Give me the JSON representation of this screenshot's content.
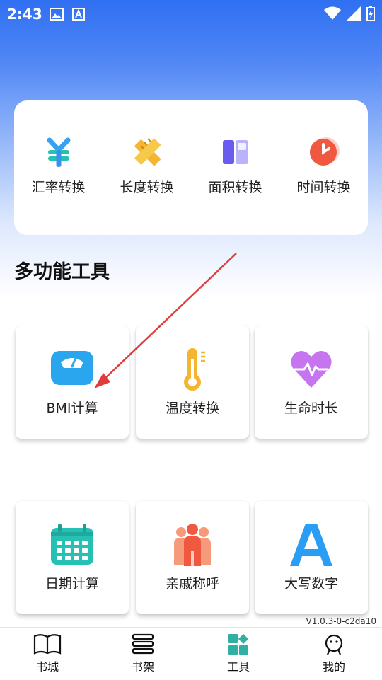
{
  "status_bar": {
    "time": "2:43"
  },
  "converters": [
    {
      "label": "汇率转换",
      "icon": "yen-icon"
    },
    {
      "label": "长度转换",
      "icon": "ruler-pencil-icon"
    },
    {
      "label": "面积转换",
      "icon": "area-icon"
    },
    {
      "label": "时间转换",
      "icon": "clock-icon"
    }
  ],
  "section": {
    "title": "多功能工具"
  },
  "tools": [
    {
      "label": "BMI计算",
      "icon": "scale-icon"
    },
    {
      "label": "温度转换",
      "icon": "thermometer-icon"
    },
    {
      "label": "生命时长",
      "icon": "heartbeat-icon"
    },
    {
      "label": "日期计算",
      "icon": "calendar-icon"
    },
    {
      "label": "亲戚称呼",
      "icon": "family-icon"
    },
    {
      "label": "大写数字",
      "icon": "letter-a-icon"
    }
  ],
  "version": "V1.0.3-0-c2da10",
  "tabbar": {
    "tabs": [
      {
        "label": "书城",
        "icon": "book-icon"
      },
      {
        "label": "书架",
        "icon": "bookshelf-icon"
      },
      {
        "label": "工具",
        "icon": "tools-icon",
        "active": true
      },
      {
        "label": "我的",
        "icon": "profile-icon"
      }
    ]
  },
  "colors": {
    "header_blue": "#2f6ff2",
    "active_tab": "#2fb0a3",
    "arrow": "#e03c3c"
  }
}
